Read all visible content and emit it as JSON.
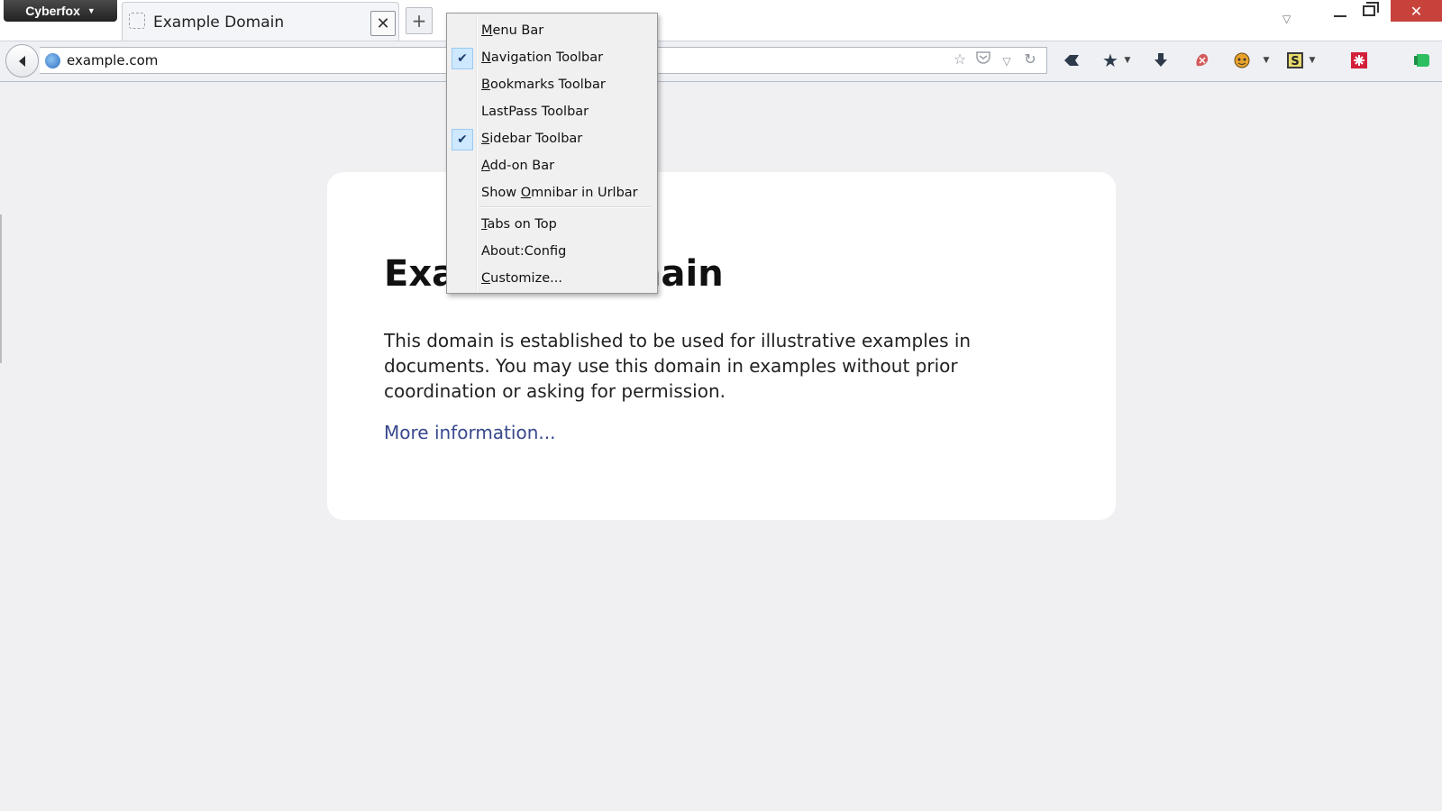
{
  "app": {
    "name": "Cyberfox"
  },
  "tab": {
    "title": "Example Domain",
    "close_glyph": "✕",
    "new_tab_glyph": "+"
  },
  "window": {
    "close_glyph": "✕"
  },
  "address": {
    "url": "example.com"
  },
  "page": {
    "heading": "Example Domain",
    "paragraph": "This domain is established to be used for illustrative examples in documents. You may use this domain in examples without prior coordination or asking for permission.",
    "link": "More information..."
  },
  "menu": {
    "items": [
      {
        "pre": "",
        "key": "M",
        "post": "enu Bar",
        "checked": false
      },
      {
        "pre": "",
        "key": "N",
        "post": "avigation Toolbar",
        "checked": true
      },
      {
        "pre": "",
        "key": "B",
        "post": "ookmarks Toolbar",
        "checked": false
      },
      {
        "pre": "LastPass Toolbar",
        "key": "",
        "post": "",
        "checked": false
      },
      {
        "pre": "",
        "key": "S",
        "post": "idebar Toolbar",
        "checked": true
      },
      {
        "pre": "",
        "key": "A",
        "post": "dd-on Bar",
        "checked": false
      },
      {
        "pre": "Show ",
        "key": "O",
        "post": "mnibar in Urlbar",
        "checked": false
      },
      {
        "pre": "",
        "key": "T",
        "post": "abs on Top",
        "checked": false
      },
      {
        "pre": "About:Config",
        "key": "",
        "post": "",
        "checked": false
      },
      {
        "pre": "",
        "key": "C",
        "post": "ustomize...",
        "checked": false
      }
    ]
  },
  "icons": {
    "toolbar": [
      "bookmark-back-icon",
      "bookmarks-star-icon",
      "downloads-icon",
      "lastpass-icon",
      "greasemonkey-icon",
      "stylish-icon",
      "addon-red-icon",
      "evernote-icon"
    ]
  },
  "colors": {
    "win_close": "#c8423c",
    "link": "#38488f",
    "check_bg": "#cde8ff"
  }
}
